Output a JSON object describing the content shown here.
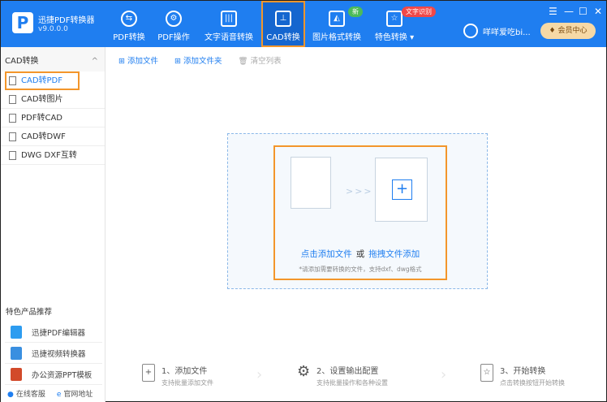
{
  "app": {
    "name": "迅捷PDF转换器",
    "version": "v9.0.0.0"
  },
  "nav": [
    {
      "label": "PDF转换",
      "icon": "pdf-convert-icon"
    },
    {
      "label": "PDF操作",
      "icon": "pdf-operate-icon"
    },
    {
      "label": "文字语音转换",
      "icon": "audio-icon"
    },
    {
      "label": "CAD转换",
      "icon": "cad-icon",
      "active": true
    },
    {
      "label": "图片格式转换",
      "icon": "image-icon",
      "badge": "新"
    },
    {
      "label": "特色转换",
      "icon": "special-icon",
      "badge": "文字识别"
    }
  ],
  "badges": {
    "new_color": "#4cbb5a",
    "ocr_color": "#f04848"
  },
  "window": {
    "menu": "☰",
    "min": "—",
    "max": "☐",
    "close": "✕"
  },
  "user": {
    "name": "咩咩爱吃bi...",
    "vip": "会员中心"
  },
  "sidebar": {
    "section": "CAD转换",
    "items": [
      {
        "label": "CAD转PDF",
        "active": true
      },
      {
        "label": "CAD转图片"
      },
      {
        "label": "PDF转CAD"
      },
      {
        "label": "CAD转DWF"
      },
      {
        "label": "DWG DXF互转"
      }
    ],
    "rec_title": "特色产品推荐",
    "recs": [
      {
        "label": "迅捷PDF编辑器"
      },
      {
        "label": "迅捷视频转换器"
      },
      {
        "label": "办公资源PPT模板"
      }
    ],
    "footer": {
      "service": "在线客服",
      "site": "官网地址"
    }
  },
  "toolbar": {
    "add_file": "添加文件",
    "add_folder": "添加文件夹",
    "clear": "清空列表"
  },
  "drop": {
    "click": "点击添加文件",
    "or": "或",
    "drag": "拖拽文件添加",
    "hint": "*请添加需要转换的文件，支持dxf、dwg格式"
  },
  "steps": [
    {
      "title": "1、添加文件",
      "desc": "支持批量添加文件"
    },
    {
      "title": "2、设置输出配置",
      "desc": "支持批量操作和各种设置"
    },
    {
      "title": "3、开始转换",
      "desc": "点击转换按钮开始转换"
    }
  ],
  "colors": {
    "brand": "#1f7ef0",
    "highlight": "#f3962b"
  }
}
